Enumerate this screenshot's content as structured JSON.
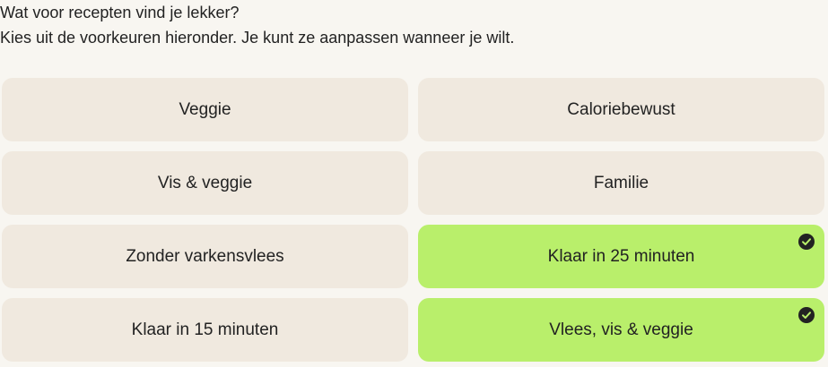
{
  "intro": {
    "question": "Wat voor recepten vind je lekker?",
    "instruction": "Kies uit de voorkeuren hieronder. Je kunt ze aanpassen wanneer je wilt."
  },
  "options": [
    {
      "label": "Veggie",
      "selected": false
    },
    {
      "label": "Caloriebewust",
      "selected": false
    },
    {
      "label": "Vis & veggie",
      "selected": false
    },
    {
      "label": "Familie",
      "selected": false
    },
    {
      "label": "Zonder varkensvlees",
      "selected": false
    },
    {
      "label": "Klaar in 25 minuten",
      "selected": true
    },
    {
      "label": "Klaar in 15 minuten",
      "selected": false
    },
    {
      "label": "Vlees, vis & veggie",
      "selected": true
    }
  ],
  "colors": {
    "page_background": "#f8f6f1",
    "option_background": "#f0e9df",
    "selected_background": "#b9ef6b",
    "text": "#222222",
    "check_icon": "#222222"
  },
  "icons": {
    "selected_indicator": "check-circle-icon"
  }
}
